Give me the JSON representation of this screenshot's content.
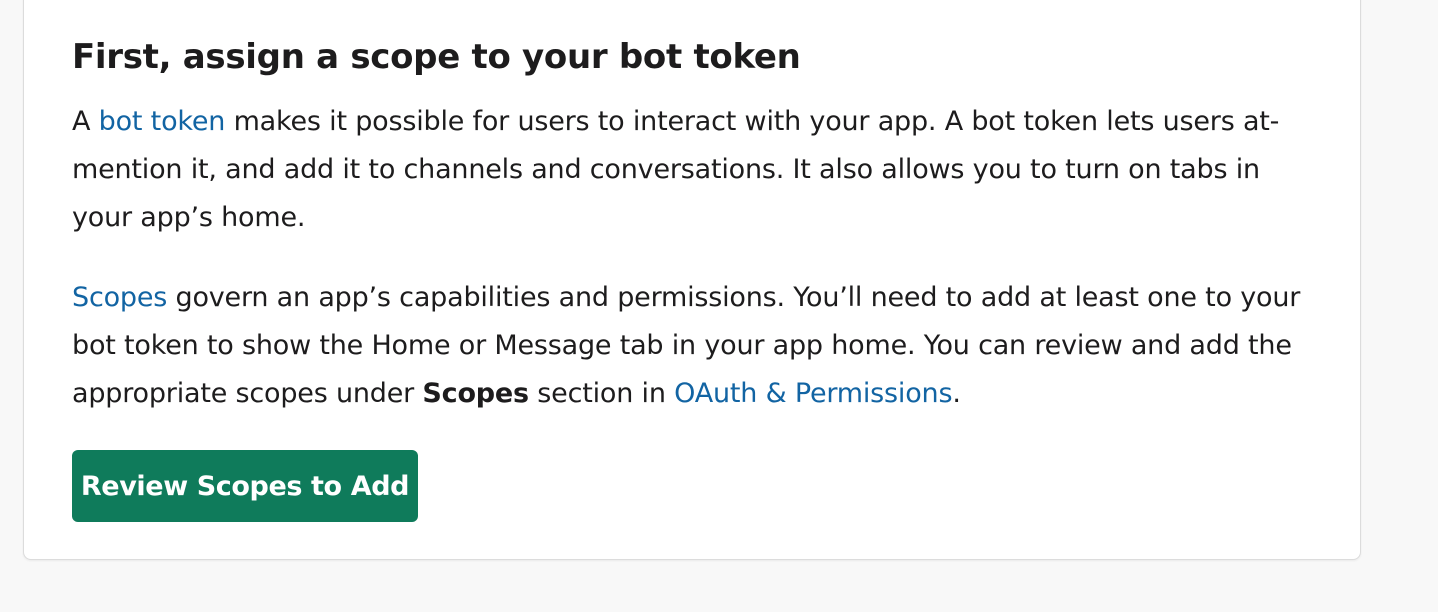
{
  "section": {
    "heading": "First, assign a scope to your bot token",
    "paragraph1": {
      "prefix": "A ",
      "link": "bot token",
      "rest": " makes it possible for users to interact with your app. A bot token lets users at-mention it, and add it to channels and conversations. It also allows you to turn on tabs in your app’s home."
    },
    "paragraph2": {
      "link_scopes": "Scopes",
      "text1": " govern an app’s capabilities and permissions. You’ll need to add at least one to your bot token to show the Home or Message tab in your app home. You can review and add the appropriate scopes under ",
      "bold": "Scopes",
      "text2": " section in ",
      "link_oauth": "OAuth & Permissions",
      "suffix": "."
    },
    "button_label": "Review Scopes to Add"
  },
  "colors": {
    "link": "#1264a3",
    "button_bg": "#0f7b5b",
    "page_bg": "#f8f8f8",
    "card_bg": "#ffffff"
  }
}
